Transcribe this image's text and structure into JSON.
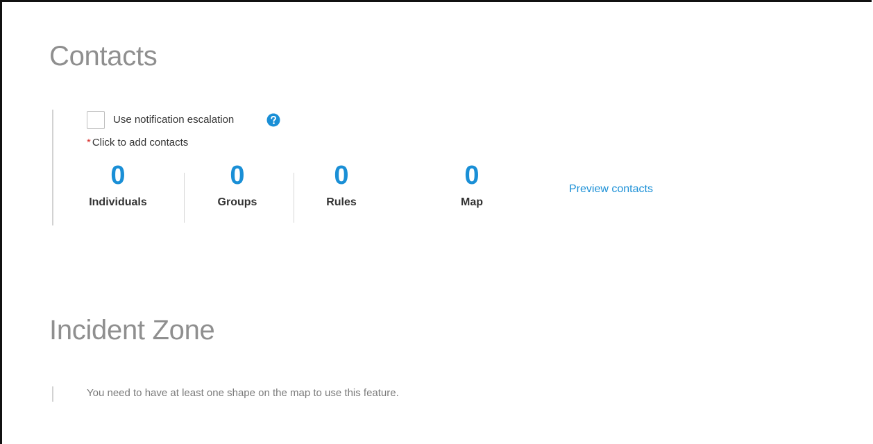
{
  "contacts": {
    "title": "Contacts",
    "escalation_checkbox": {
      "label": "Use notification escalation",
      "checked": false,
      "help_icon": "question-circle-icon"
    },
    "required_marker": "*",
    "add_contacts_hint": "Click to add contacts",
    "stats": [
      {
        "count": "0",
        "label": "Individuals"
      },
      {
        "count": "0",
        "label": "Groups"
      },
      {
        "count": "0",
        "label": "Rules"
      },
      {
        "count": "0",
        "label": "Map"
      }
    ],
    "preview_link": "Preview contacts"
  },
  "incident_zone": {
    "title": "Incident Zone",
    "message": "You need to have at least one shape on the map to use this feature."
  },
  "colors": {
    "accent": "#1a8fd6",
    "required": "#d9302c",
    "title": "#8f8f8f"
  }
}
